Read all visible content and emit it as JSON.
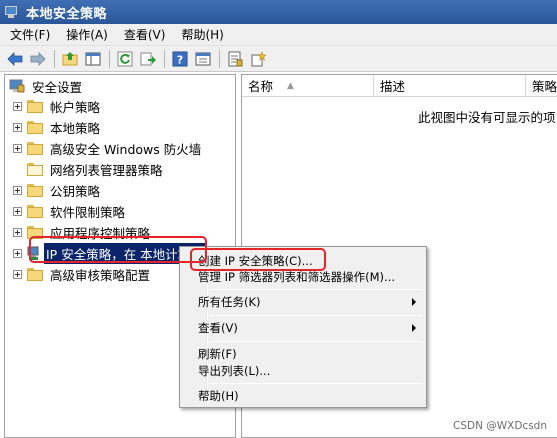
{
  "window": {
    "title": "本地安全策略"
  },
  "menu": [
    {
      "label": "文件(F)"
    },
    {
      "label": "操作(A)"
    },
    {
      "label": "查看(V)"
    },
    {
      "label": "帮助(H)"
    }
  ],
  "toolbar": {
    "icons": [
      "back-arrow-icon",
      "forward-arrow-icon",
      "up-folder-icon",
      "show-hide-tree-icon",
      "refresh-icon",
      "export-list-icon",
      "help-icon",
      "properties-icon",
      "policy-icon",
      "policy-wizard-icon"
    ]
  },
  "tree": {
    "root": "安全设置",
    "items": [
      {
        "label": "帐户策略",
        "expandable": true
      },
      {
        "label": "本地策略",
        "expandable": true
      },
      {
        "label": "高级安全 Windows 防火墙",
        "expandable": true
      },
      {
        "label": "网络列表管理器策略",
        "expandable": false
      },
      {
        "label": "公钥策略",
        "expandable": true
      },
      {
        "label": "软件限制策略",
        "expandable": true
      },
      {
        "label": "应用程序控制策略",
        "expandable": true
      },
      {
        "label": "IP 安全策略，在 本地计算机",
        "expandable": true,
        "selected": true
      },
      {
        "label": "高级审核策略配置",
        "expandable": true
      }
    ]
  },
  "list": {
    "columns": [
      "名称",
      "描述",
      "策略"
    ],
    "empty_message": "此视图中没有可显示的项目"
  },
  "context_menu": {
    "items": [
      {
        "label": "创建 IP 安全策略(C)..."
      },
      {
        "label": "管理 IP 筛选器列表和筛选器操作(M)..."
      },
      {
        "label": "所有任务(K)",
        "submenu": true
      },
      {
        "label": "查看(V)",
        "submenu": true
      },
      {
        "label": "刷新(F)"
      },
      {
        "label": "导出列表(L)..."
      },
      {
        "label": "帮助(H)"
      }
    ]
  },
  "watermark": "CSDN @WXDcsdn",
  "colors": {
    "highlight": "#e4252a",
    "selection": "#0a246a",
    "titlebar": "#2a5699"
  }
}
